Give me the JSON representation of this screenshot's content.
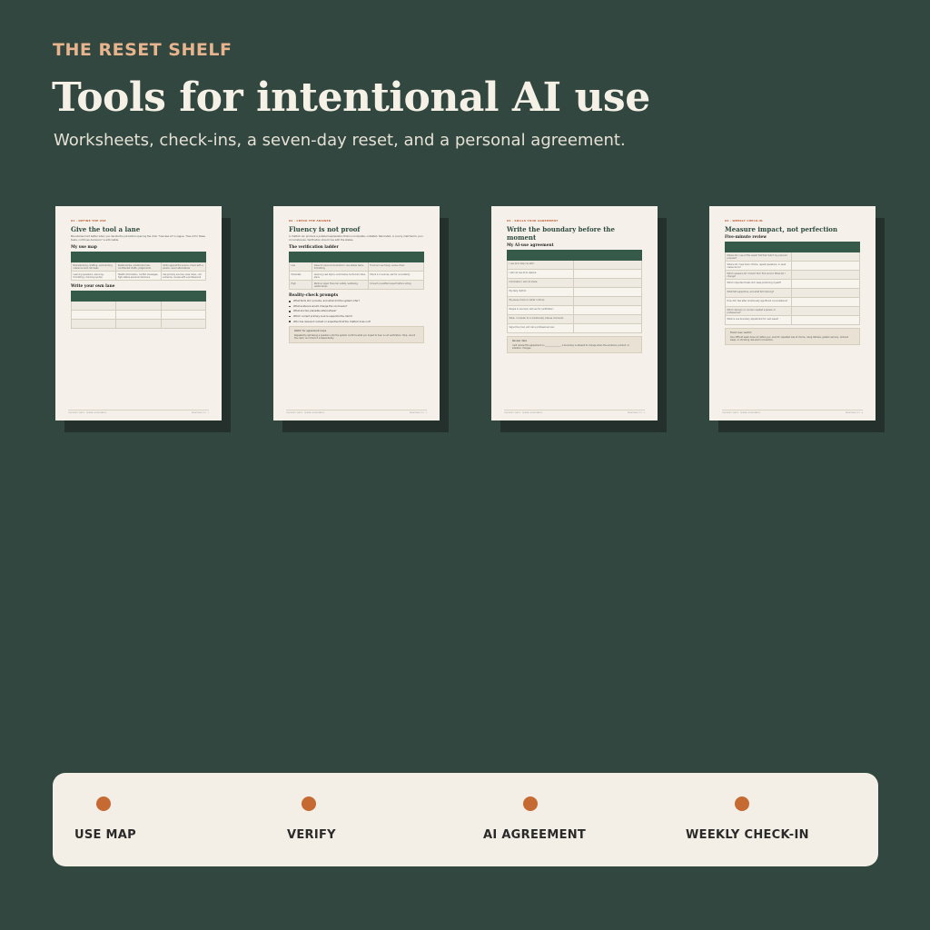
{
  "header": {
    "brand": "THE RESET SHELF",
    "title": "Tools for intentional AI use",
    "subtitle": "Worksheets, check-ins, a seven-day reset, and a personal agreement."
  },
  "sheets": [
    {
      "kicker": "01 · DEFINE THE USE",
      "title": "Give the tool a lane",
      "intro": "Boundaries hold better when you decide the job before opening the chat. \"Use less AI\" is vague. \"Use AI for these tasks, not those decisions\" is actionable.",
      "section1": "My use map",
      "map_rows": [
        [
          "Brainstorming, drafting, summarizing reference text, list ideas",
          "Relationships, emotional/crisis, confidential drafts, judgements",
          "Verify against the source, check with a person, avoid alternatives"
        ],
        [
          "Learning questions, planning, formatting, checking syntax",
          "Health information, conflict messages, high-stakes personal decisions",
          "Use primary sources, slow down, call someone, review with a professional"
        ]
      ],
      "section2": "Write your own lane",
      "footer_left": "THE RESET SHELF · DIGITAL WORKSHEETS",
      "footer_right": "RESETSHELF.CO · 1"
    },
    {
      "kicker": "02 · CHECK THE ANSWER",
      "title": "Fluency is not proof",
      "intro": "A chatbot can produce a polished explanation that is incomplete, outdated, fabricated, or poorly matched to your circumstances. Verification should rise with the stakes.",
      "section1": "The verification ladder",
      "ladder_rows": [
        [
          "Low",
          "Ideas for personal brainstorm, low-stakes tasks, formatting",
          "Trust and use freely, sense-check"
        ],
        [
          "Moderate",
          "Learning new topics, summaries, technical notes, plans",
          "Check 1-2 sources, ask for uncertainty"
        ],
        [
          "High",
          "Medical, legal, financial, safety, wellbeing, relationships",
          "Consult a qualified expert before acting"
        ]
      ],
      "section2": "Reality-check prompts",
      "prompts": [
        "What facts did I provide, and what did the system infer?",
        "What evidence would change the conclusion?",
        "What are two plausible alternatives?",
        "Which current primary source supports the claim?",
        "Who has relevant context or expertise that the chatbot does not?"
      ],
      "box_title": "Watch for agreement loops",
      "box_body": "Repeatedly rephrasing a question until the system confirms what you hoped to hear is not verification. Stop, record the claim, and check it independently.",
      "footer_left": "THE RESET SHELF · DIGITAL WORKSHEETS",
      "footer_right": "RESETSHELF.CO · 2"
    },
    {
      "kicker": "03 · SKILLS YOUR AGREEMENT",
      "title": "Write the boundary before the moment",
      "section1": "My AI-use agreement",
      "agreement_rows": [
        "I use AI to help me with:",
        "I will not use AI to replace:",
        "Information I will not share:",
        "My daily rhythm:",
        "My pause check-in (what I notice):",
        "People or sources I will use for verification:",
        "When I consider AI in emotionally intense moments:",
        "Signs this (me): will call a professional now:"
      ],
      "box_title": "Review date",
      "box_body": "I will review this agreement on _______________. A boundary is allowed to change when the evidence, product, or situation changes.",
      "footer_left": "THE RESET SHELF · DIGITAL WORKSHEETS",
      "footer_right": "RESETSHELF.CO · 3"
    },
    {
      "kicker": "04 · WEEKLY CHECK-IN",
      "title": "Measure impact, not perfection",
      "section1": "Five-minute review",
      "review_rows": [
        "Where did I use AI this week? Did that match my planned purpose?",
        "Where did I lose track of time, repeat questions, or seek reassurance?",
        "Which answers did I check? Did I find errors? What did I change?",
        "Which important tasks did I keep practicing myself?",
        "What felt supportive, and what felt draining?",
        "How did I feel after emotionally significant conversations?",
        "Which decision or concern needed a person or professional?",
        "What is one boundary adjustment for next week?"
      ],
      "box_title": "Trend over verdict",
      "box_body": "One difficult week does not define you. Look for repeated loss of choice, rising distress, greater secrecy, reduced sleep, or shrinking real-world connection.",
      "footer_left": "THE RESET SHELF · DIGITAL WORKSHEETS",
      "footer_right": "RESETSHELF.CO · 4"
    }
  ],
  "legend": {
    "accent_color": "#c66a33",
    "items": [
      "USE MAP",
      "VERIFY",
      "AI AGREEMENT",
      "WEEKLY CHECK-IN"
    ]
  }
}
